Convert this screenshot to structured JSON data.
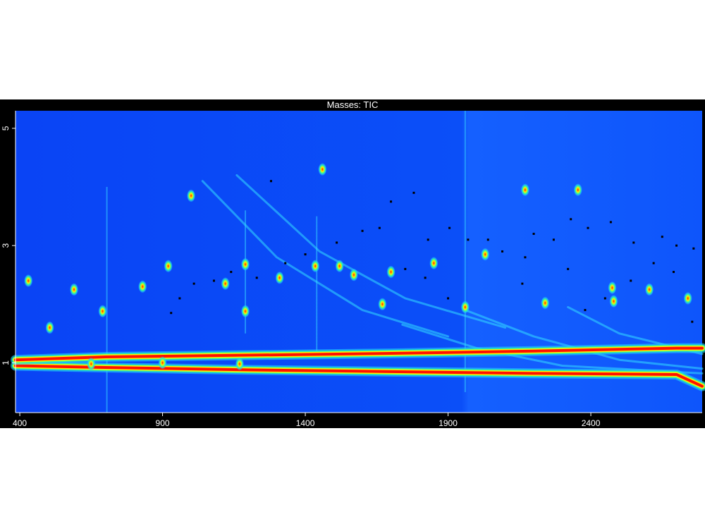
{
  "chart_data": {
    "type": "heatmap",
    "title": "Masses:  TIC",
    "xlabel": "",
    "ylabel": "",
    "xlim": [
      385,
      2790
    ],
    "ylim": [
      0.15,
      5.3
    ],
    "x_ticks": [
      400,
      900,
      1400,
      1900,
      2400
    ],
    "y_ticks": [
      1,
      3,
      5
    ],
    "colormap": [
      "#0022ee",
      "#0a66ff",
      "#22ccff",
      "#33ff99",
      "#ffee00",
      "#ff0000"
    ],
    "bands": [
      {
        "name": "",
        "x": [
          385,
          700,
          1200,
          1700,
          2200,
          2700,
          2790
        ],
        "y": [
          0.95,
          0.92,
          0.88,
          0.85,
          0.82,
          0.8,
          0.6
        ]
      },
      {
        "name": "",
        "x": [
          385,
          700,
          1200,
          1700,
          2200,
          2700,
          2790
        ],
        "y": [
          1.05,
          1.1,
          1.13,
          1.16,
          1.2,
          1.25,
          1.25
        ]
      }
    ],
    "spots": [
      [
        690,
        1.88
      ],
      [
        1000,
        3.85
      ],
      [
        1190,
        2.68
      ],
      [
        1190,
        1.88
      ],
      [
        1435,
        2.65
      ],
      [
        1460,
        4.3
      ],
      [
        1570,
        2.5
      ],
      [
        1670,
        2.0
      ],
      [
        2170,
        3.95
      ],
      [
        2355,
        3.95
      ],
      [
        2475,
        2.28
      ],
      [
        2480,
        2.05
      ],
      [
        1960,
        1.95
      ],
      [
        2240,
        2.02
      ],
      [
        2030,
        2.85
      ],
      [
        1850,
        2.7
      ],
      [
        1700,
        2.55
      ],
      [
        1520,
        2.65
      ],
      [
        1310,
        2.45
      ],
      [
        1120,
        2.35
      ],
      [
        920,
        2.65
      ],
      [
        830,
        2.3
      ],
      [
        590,
        2.25
      ],
      [
        505,
        1.6
      ],
      [
        430,
        2.4
      ],
      [
        650,
        0.98
      ],
      [
        900,
        1.0
      ],
      [
        1170,
        0.98
      ],
      [
        2605,
        2.25
      ],
      [
        2740,
        2.1
      ]
    ],
    "curves": [
      {
        "x": [
          1960,
          2200,
          2500,
          2790
        ],
        "y": [
          1.9,
          1.45,
          1.05,
          0.9
        ]
      },
      {
        "x": [
          1740,
          2000,
          2300,
          2790
        ],
        "y": [
          1.65,
          1.25,
          0.95,
          0.82
        ]
      },
      {
        "x": [
          2320,
          2500,
          2790
        ],
        "y": [
          1.95,
          1.5,
          1.15
        ]
      },
      {
        "x": [
          1040,
          1300,
          1600,
          1900
        ],
        "y": [
          4.1,
          2.8,
          1.9,
          1.45
        ]
      },
      {
        "x": [
          1160,
          1450,
          1750,
          2100
        ],
        "y": [
          4.2,
          2.9,
          2.1,
          1.6
        ]
      }
    ],
    "streaks": [
      {
        "x": 705,
        "y": [
          0.15,
          4.0
        ]
      },
      {
        "x": 1190,
        "y": [
          1.5,
          3.6
        ]
      },
      {
        "x": 1440,
        "y": [
          1.2,
          3.5
        ]
      },
      {
        "x": 1960,
        "y": [
          0.5,
          5.3
        ]
      }
    ],
    "markers": [
      [
        1280,
        4.1
      ],
      [
        1700,
        3.75
      ],
      [
        1780,
        3.9
      ],
      [
        1830,
        3.1
      ],
      [
        1905,
        3.3
      ],
      [
        1970,
        3.1
      ],
      [
        2040,
        3.1
      ],
      [
        2200,
        3.2
      ],
      [
        2270,
        3.1
      ],
      [
        2330,
        3.45
      ],
      [
        2390,
        3.3
      ],
      [
        2470,
        3.4
      ],
      [
        2550,
        3.05
      ],
      [
        2650,
        3.15
      ],
      [
        2700,
        3.0
      ],
      [
        2760,
        2.95
      ],
      [
        1600,
        3.25
      ],
      [
        1660,
        3.3
      ],
      [
        1510,
        3.05
      ],
      [
        1400,
        2.85
      ],
      [
        1230,
        2.45
      ],
      [
        1330,
        2.7
      ],
      [
        1140,
        2.55
      ],
      [
        1080,
        2.4
      ],
      [
        1010,
        2.35
      ],
      [
        930,
        1.85
      ],
      [
        960,
        2.1
      ],
      [
        2090,
        2.9
      ],
      [
        2170,
        2.8
      ],
      [
        2320,
        2.6
      ],
      [
        2380,
        1.9
      ],
      [
        2450,
        2.1
      ],
      [
        2540,
        2.4
      ],
      [
        2620,
        2.7
      ],
      [
        2690,
        2.55
      ],
      [
        2755,
        1.7
      ],
      [
        2160,
        2.35
      ],
      [
        1750,
        2.6
      ],
      [
        1820,
        2.45
      ],
      [
        1900,
        2.1
      ]
    ]
  }
}
